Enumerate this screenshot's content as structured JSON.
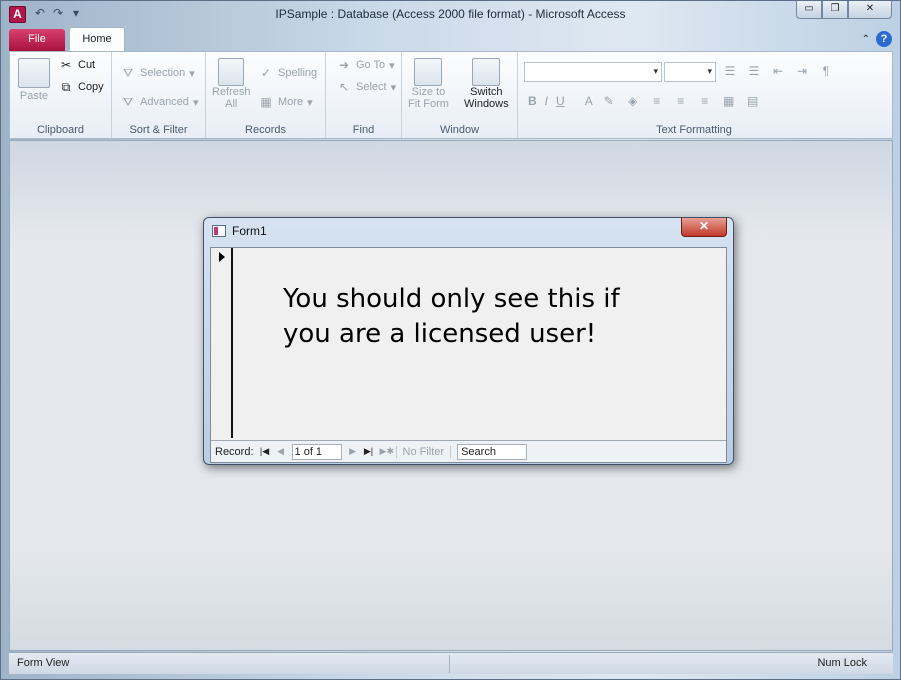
{
  "window": {
    "title": "IPSample : Database (Access 2000 file format)  -  Microsoft Access",
    "app_icon": "A"
  },
  "qat": {
    "undo": "↶",
    "redo": "↷",
    "more": "▾"
  },
  "caption": {
    "minimize": "▭",
    "restore": "❐",
    "close": "✕"
  },
  "tabs": {
    "file": "File",
    "home": "Home"
  },
  "ribbon": {
    "clipboard": {
      "label": "Clipboard",
      "paste": "Paste",
      "cut": "Cut",
      "copy": "Copy"
    },
    "sort_filter": {
      "label": "Sort & Filter",
      "selection": "Selection",
      "advanced": "Advanced"
    },
    "records": {
      "label": "Records",
      "refresh": "Refresh",
      "all": "All",
      "spelling": "Spelling",
      "more": "More"
    },
    "find": {
      "label": "Find",
      "goto": "Go To",
      "select": "Select"
    },
    "window": {
      "label": "Window",
      "size_to": "Size to",
      "fit_form": "Fit Form",
      "switch": "Switch",
      "windows": "Windows"
    },
    "text_formatting": {
      "label": "Text Formatting",
      "bold": "B",
      "italic": "I",
      "underline": "U",
      "font_color": "A"
    }
  },
  "form": {
    "title": "Form1",
    "message": "You should only see this if you are a licensed user!",
    "nav": {
      "record_label": "Record:",
      "position": "1 of 1",
      "filter": "No Filter",
      "search_placeholder": "Search"
    }
  },
  "status": {
    "left": "Form View",
    "right": "Num Lock"
  }
}
